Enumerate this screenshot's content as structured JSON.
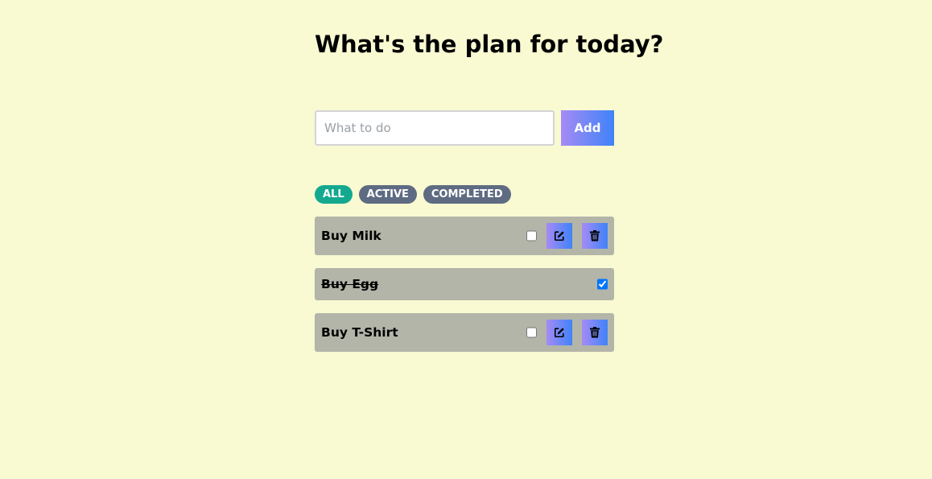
{
  "header": {
    "title": "What's the plan for today?"
  },
  "form": {
    "placeholder": "What to do",
    "value": "",
    "add_label": "Add"
  },
  "filters": [
    {
      "label": "ALL",
      "selected": true
    },
    {
      "label": "ACTIVE",
      "selected": false
    },
    {
      "label": "COMPLETED",
      "selected": false
    }
  ],
  "todos": [
    {
      "text": "Buy Milk",
      "completed": false,
      "actions": [
        "edit-icon",
        "trash-icon"
      ]
    },
    {
      "text": "Buy Egg",
      "completed": true,
      "actions": []
    },
    {
      "text": "Buy T-Shirt",
      "completed": false,
      "actions": [
        "edit-icon",
        "trash-icon"
      ]
    }
  ],
  "colors": {
    "background": "#f9f9d2",
    "item_background": "#b3b5a8",
    "filter_selected": "#14a98f",
    "filter_default": "#5e6b82",
    "button_gradient_start": "#a58bf5",
    "button_gradient_end": "#3f83f8"
  }
}
